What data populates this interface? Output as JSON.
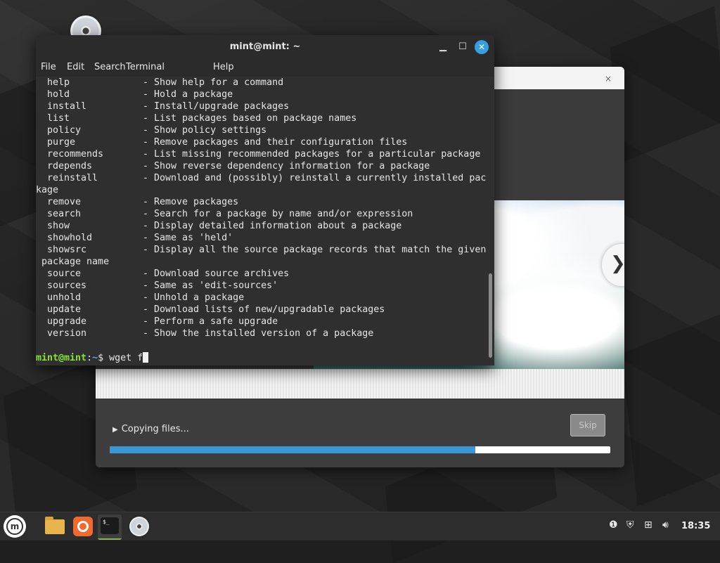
{
  "terminal": {
    "title": "mint@mint: ~",
    "menu": [
      "File",
      "Edit",
      "Search",
      "Terminal",
      "Help"
    ],
    "lines": [
      {
        "cmd": "help",
        "desc": "- Show help for a command"
      },
      {
        "cmd": "hold",
        "desc": "- Hold a package"
      },
      {
        "cmd": "install",
        "desc": "- Install/upgrade packages"
      },
      {
        "cmd": "list",
        "desc": "- List packages based on package names"
      },
      {
        "cmd": "policy",
        "desc": "- Show policy settings"
      },
      {
        "cmd": "purge",
        "desc": "- Remove packages and their configuration files"
      },
      {
        "cmd": "recommends",
        "desc": "- List missing recommended packages for a particular package"
      },
      {
        "cmd": "rdepends",
        "desc": "- Show reverse dependency information for a package"
      },
      {
        "cmd": "reinstall",
        "desc": "- Download and (possibly) reinstall a currently installed pac"
      },
      {
        "raw": "kage"
      },
      {
        "cmd": "remove",
        "desc": "- Remove packages"
      },
      {
        "cmd": "search",
        "desc": "- Search for a package by name and/or expression"
      },
      {
        "cmd": "show",
        "desc": "- Display detailed information about a package"
      },
      {
        "cmd": "showhold",
        "desc": "- Same as 'held'"
      },
      {
        "cmd": "showsrc",
        "desc": "- Display all the source package records that match the given"
      },
      {
        "raw": " package name"
      },
      {
        "cmd": "source",
        "desc": "- Download source archives"
      },
      {
        "cmd": "sources",
        "desc": "- Same as 'edit-sources'"
      },
      {
        "cmd": "unhold",
        "desc": "- Unhold a package"
      },
      {
        "cmd": "update",
        "desc": "- Download lists of new/upgradable packages"
      },
      {
        "cmd": "upgrade",
        "desc": "- Perform a safe upgrade"
      },
      {
        "cmd": "version",
        "desc": "- Show the installed version of a package"
      }
    ],
    "prompt": {
      "user": "mint@mint",
      "sep": ":",
      "path": "~",
      "symbol": "$",
      "input": " wget f"
    }
  },
  "installer": {
    "close_glyph": "×",
    "status": "Copying files...",
    "skip_label": "Skip",
    "progress_percent": 73,
    "next_glyph": "❯"
  },
  "taskbar": {
    "clock": "18:35",
    "terminal_glyph": "$_"
  },
  "colors": {
    "accent": "#35a0e0",
    "progress": "#3a97d6",
    "prompt_user": "#8ae234",
    "prompt_path": "#5aa0ff"
  }
}
